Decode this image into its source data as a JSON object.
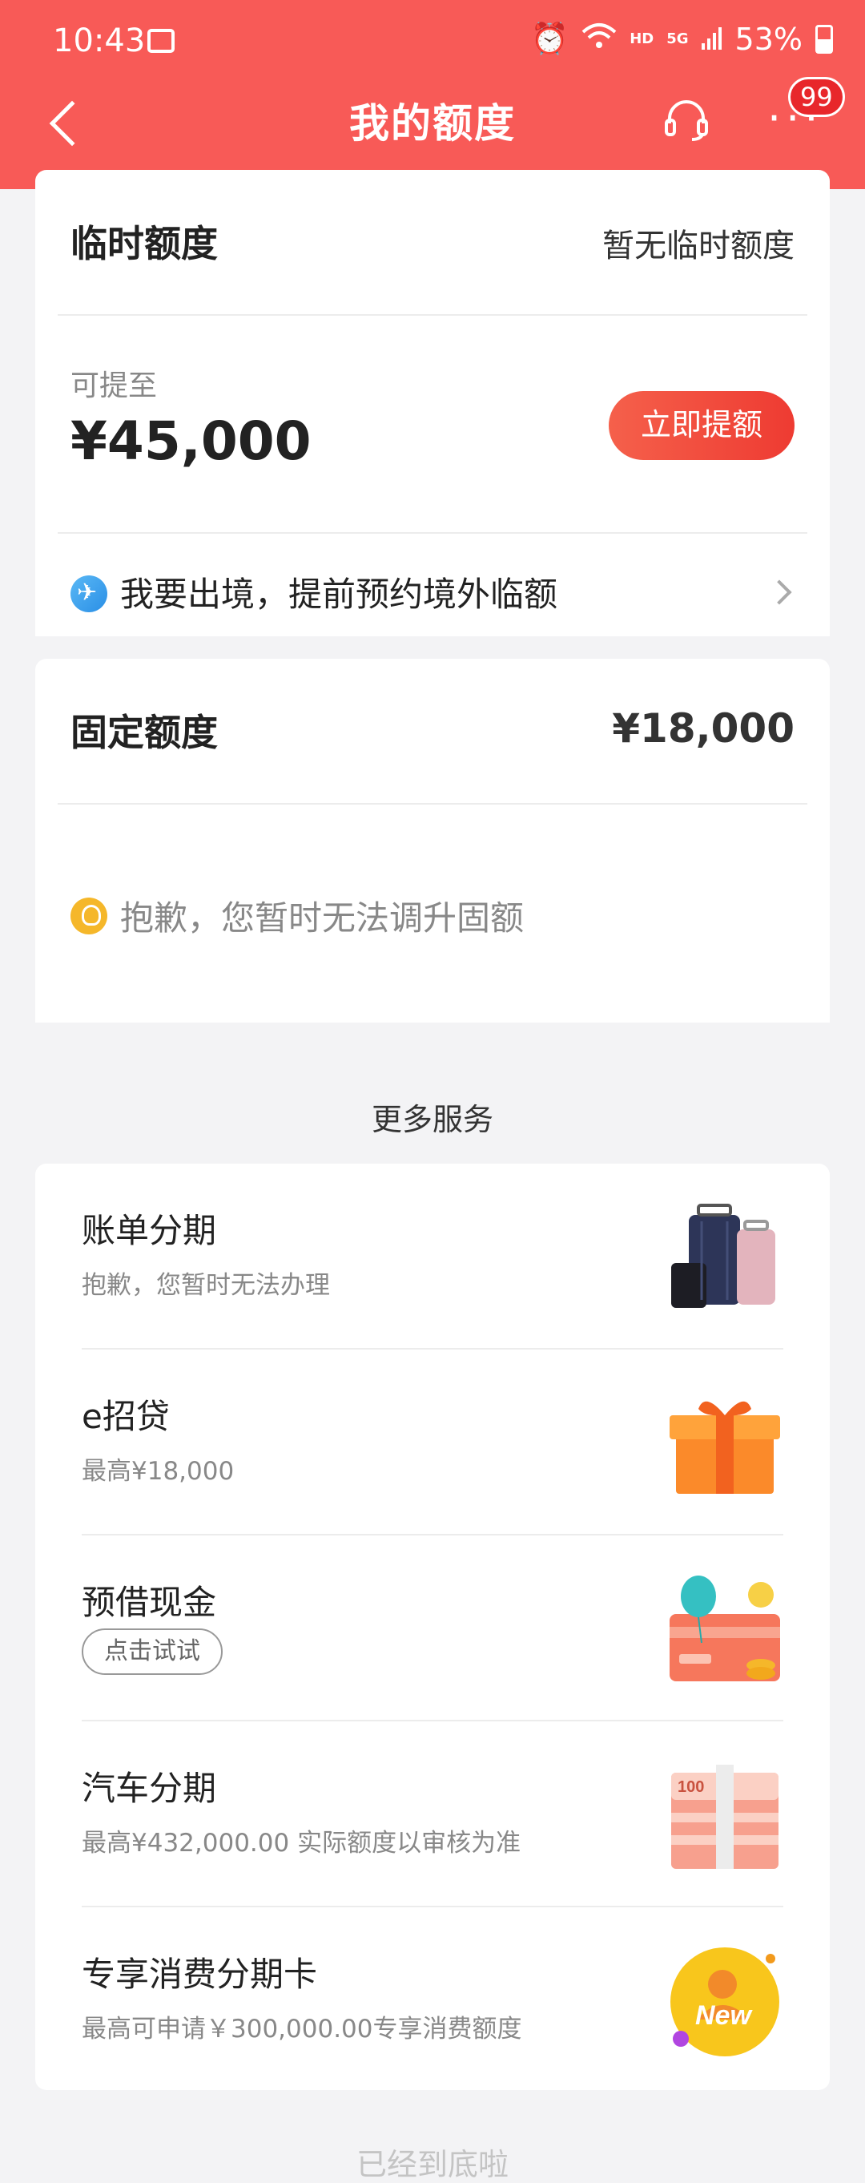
{
  "status_bar": {
    "time": "10:43",
    "hd": "HD",
    "net": "5G",
    "battery": "53%"
  },
  "nav": {
    "title": "我的额度",
    "badge": "99"
  },
  "temp_limit": {
    "title": "临时额度",
    "status": "暂无临时额度",
    "sub_label": "可提至",
    "amount": "¥45,000",
    "button": "立即提额",
    "abroad_text": "我要出境，提前预约境外临额"
  },
  "fixed_limit": {
    "title": "固定额度",
    "amount": "¥18,000",
    "notice": "抱歉，您暂时无法调升固额"
  },
  "more_services": {
    "title": "更多服务",
    "items": [
      {
        "title": "账单分期",
        "sub": "抱歉，您暂时无法办理",
        "icon": "luggage-icon"
      },
      {
        "title": "e招贷",
        "sub": "最高¥18,000",
        "icon": "gift-box-icon"
      },
      {
        "title": "预借现金",
        "pill": "点击试试",
        "icon": "card-balloon-icon"
      },
      {
        "title": "汽车分期",
        "sub": "最高¥432,000.00 实际额度以审核为准",
        "icon": "cash-stack-icon"
      },
      {
        "title": "专享消费分期卡",
        "sub": "最高可申请￥300,000.00专享消费额度",
        "icon": "new-badge-icon",
        "icon_text": "New"
      }
    ]
  },
  "footer": {
    "text": "已经到底啦"
  },
  "colors": {
    "header": "#f85a57",
    "accent": "#ee3b32",
    "background": "#f3f3f5"
  }
}
